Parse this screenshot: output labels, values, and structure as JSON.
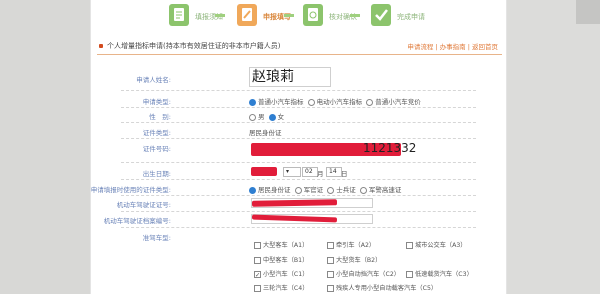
{
  "steps": [
    {
      "label": "填报须知"
    },
    {
      "label": "申报填写"
    },
    {
      "label": "核对确认"
    },
    {
      "label": "完成申请"
    }
  ],
  "section": {
    "title": "个人增量指标申请(持本市有效居住证的非本市户籍人员)",
    "links": "申请流程 | 办事指南 | 返回首页"
  },
  "form": {
    "name_label": "申请人姓名:",
    "name_value": "赵琅莉",
    "type_label": "申请类型:",
    "type_options": [
      "普通小汽车指标",
      "电动小汽车指标",
      "普通小汽车竞价"
    ],
    "gender_label": "性　别:",
    "gender_options": [
      "男",
      "女"
    ],
    "doc_type_label": "证件类型:",
    "doc_type_value": "居民身份证",
    "doc_no_label": "证件号码:",
    "doc_no_fragment": "1121332",
    "birth_label": "出生日期:",
    "birth_month": "02",
    "birth_month_unit": "月",
    "birth_day": "14",
    "birth_day_unit": "日",
    "vehicle_doc_label": "申请填报时使用的证件类型:",
    "vehicle_doc_options": [
      "居民身份证",
      "军官证",
      "士兵证",
      "军警高速证"
    ],
    "license_label": "机动车驾驶证证号:",
    "file_label": "机动车驾驶证档案编号:",
    "vehicle_class_label": "准驾车型:",
    "classes": [
      [
        "大型客车（A1）",
        "牵引车（A2）",
        "城市公交车（A3）"
      ],
      [
        "中型客车（B1）",
        "大型货车（B2）",
        ""
      ],
      [
        "小型汽车（C1）",
        "小型自动挡汽车（C2）",
        "低速载货汽车（C3）"
      ],
      [
        "三轮汽车（C4）",
        "残疾人专用小型自动载客汽车（C5）",
        ""
      ]
    ],
    "checked_class": "小型汽车（C1）"
  },
  "colors": {
    "accent_orange": "#f0a85a",
    "step_green": "#8cc46c",
    "redaction": "#e11d3a",
    "label_blue": "#6a83b8"
  }
}
